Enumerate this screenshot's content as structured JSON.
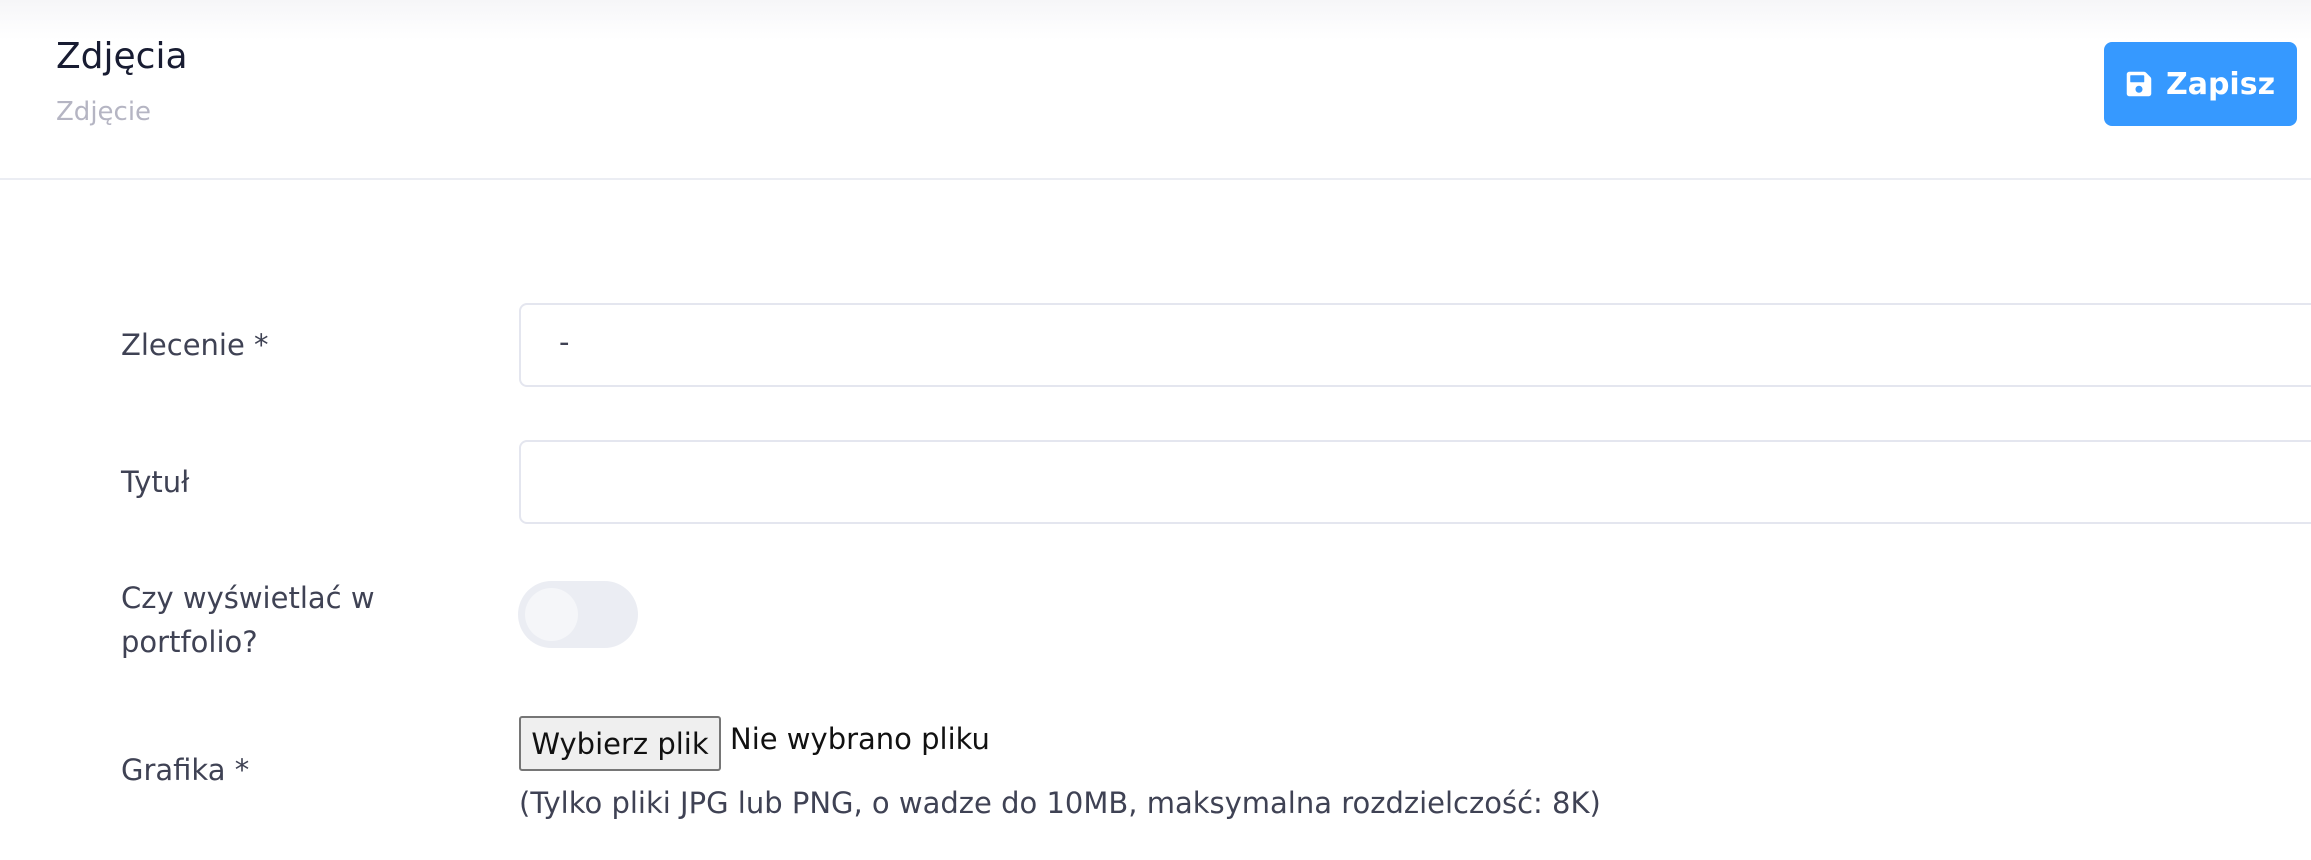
{
  "header": {
    "title": "Zdjęcia",
    "subtitle": "Zdjęcie",
    "save_label": "Zapisz",
    "save_icon": "save-icon",
    "accent_color": "#3699ff"
  },
  "form": {
    "order": {
      "label": "Zlecenie *",
      "value": "-"
    },
    "title": {
      "label": "Tytuł",
      "value": ""
    },
    "portfolio": {
      "label_line1": "Czy wyświetlać w",
      "label_line2": "portfolio?",
      "checked": false
    },
    "graphic": {
      "label": "Grafika *",
      "button_label": "Wybierz plik",
      "status": "Nie wybrano pliku",
      "hint": "(Tylko pliki JPG lub PNG, o wadze do 10MB, maksymalna rozdzielczość: 8K)"
    }
  }
}
